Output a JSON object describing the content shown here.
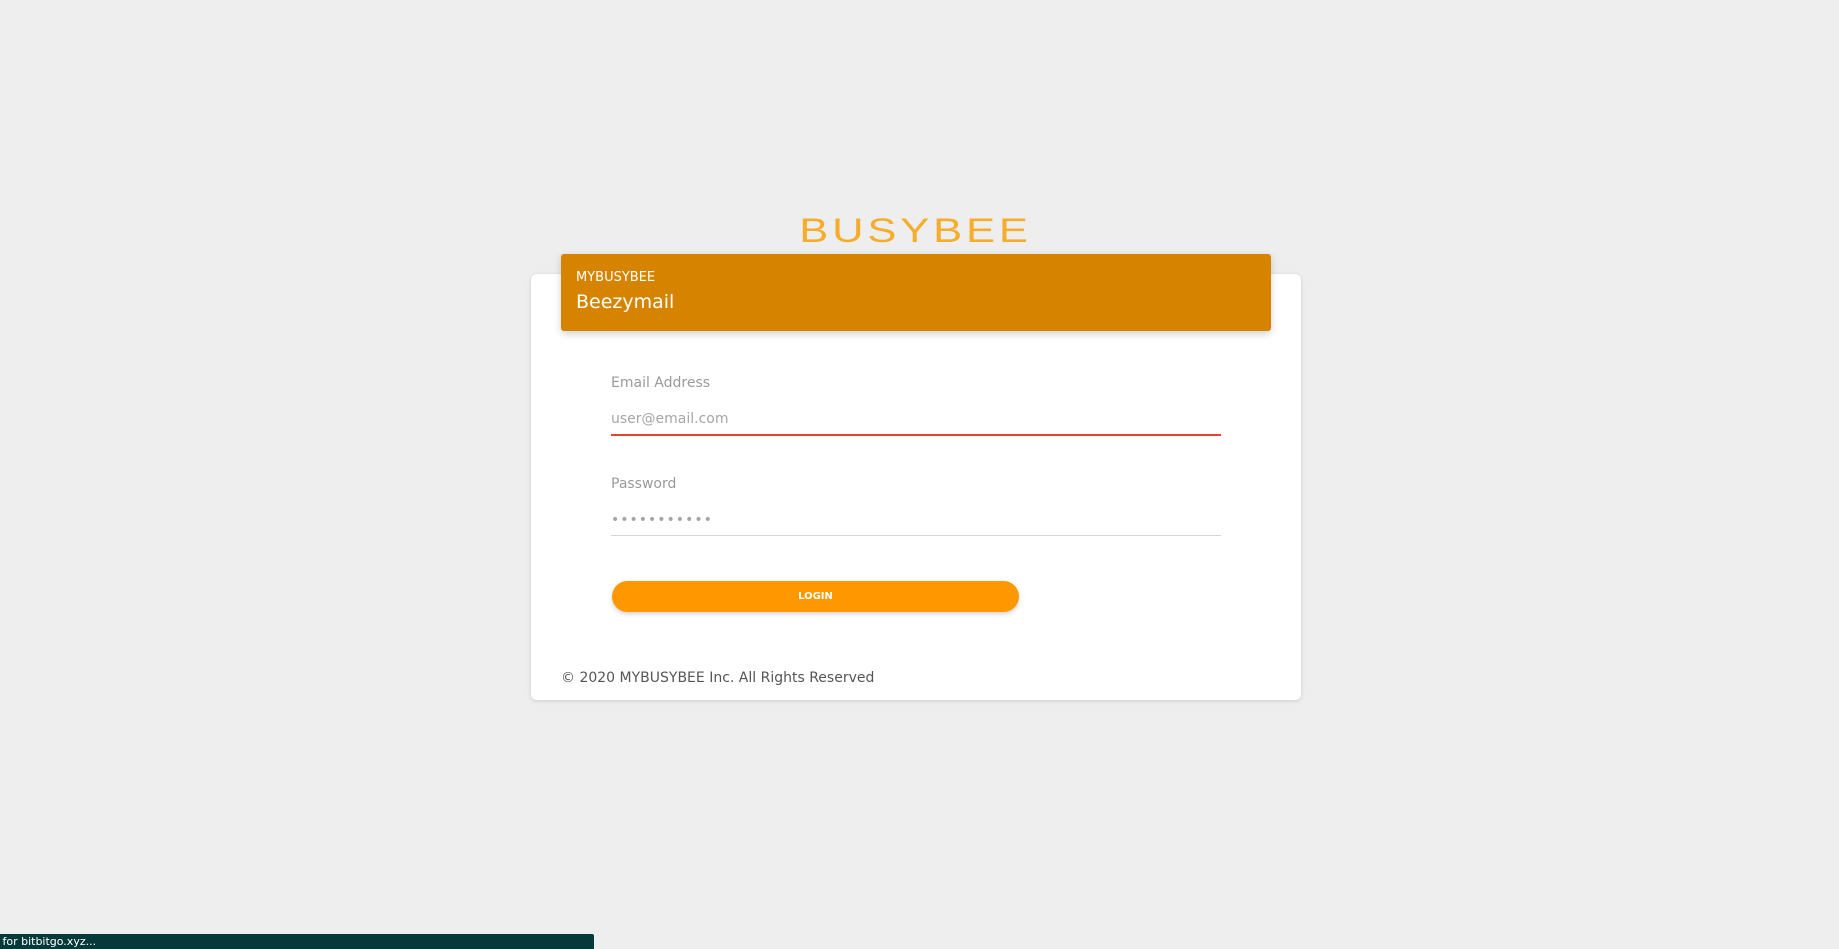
{
  "logo": {
    "text": "BUSYBEE",
    "color": "#f5ad2b"
  },
  "header": {
    "brand_label": "MYBUSYBEE",
    "title": "Beezymail",
    "background_color": "#d68400"
  },
  "form": {
    "email": {
      "label": "Email Address",
      "placeholder": "user@email.com",
      "underline_color": "#e0452d"
    },
    "password": {
      "label": "Password",
      "placeholder": "•••••••••••"
    },
    "login_button": {
      "label": "LOGIN",
      "color": "#ff9800"
    }
  },
  "footer": {
    "copyright": "© 2020 MYBUSYBEE Inc. All Rights Reserved"
  },
  "browser_status": {
    "text": "n for bitbitgo.xyz..."
  }
}
